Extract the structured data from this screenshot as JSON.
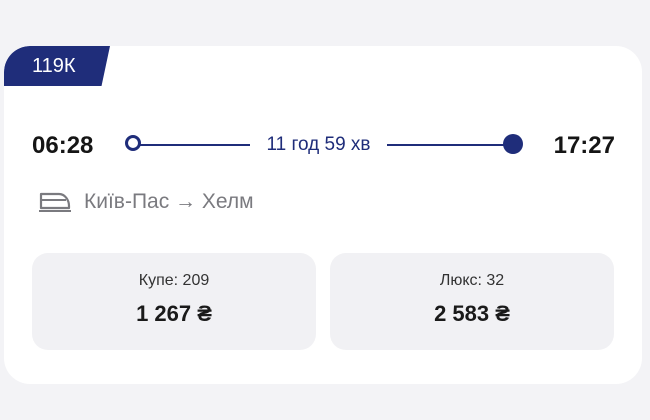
{
  "train": {
    "number": "119К"
  },
  "schedule": {
    "departure_time": "06:28",
    "arrival_time": "17:27",
    "duration": "11 год 59 хв"
  },
  "route": {
    "text": "Київ-Пас → Хелм",
    "icon": "train-icon"
  },
  "classes": [
    {
      "label": "Купе: 209",
      "price": "1 267 ₴"
    },
    {
      "label": "Люкс: 32",
      "price": "2 583 ₴"
    }
  ],
  "colors": {
    "accent": "#1f2d7a",
    "background": "#f3f3f6",
    "card": "#ffffff",
    "class_box": "#f1f1f4"
  }
}
